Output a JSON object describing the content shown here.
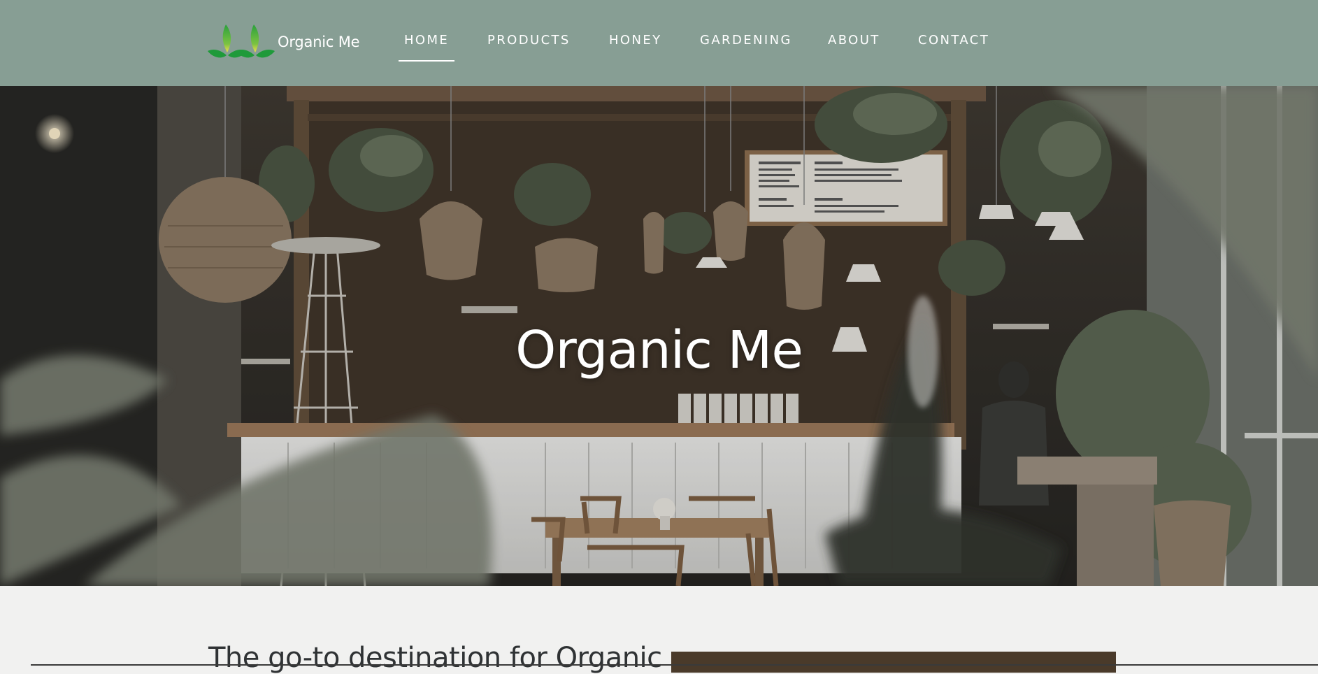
{
  "brand": {
    "name": "Organic Me",
    "leaf_colors": [
      "#1f9a3a",
      "#7cc242",
      "#f2e14b"
    ]
  },
  "nav": {
    "items": [
      {
        "label": "HOME",
        "active": true
      },
      {
        "label": "PRODUCTS",
        "active": false
      },
      {
        "label": "HONEY",
        "active": false
      },
      {
        "label": "GARDENING",
        "active": false
      },
      {
        "label": "ABOUT",
        "active": false
      },
      {
        "label": "CONTACT",
        "active": false
      }
    ]
  },
  "hero": {
    "title": "Organic Me"
  },
  "intro": {
    "heading": "The go-to destination for Organic"
  },
  "colors": {
    "header_bg": "#879e94",
    "page_bg": "#f1f1f0",
    "text_dark": "#2f3234"
  }
}
